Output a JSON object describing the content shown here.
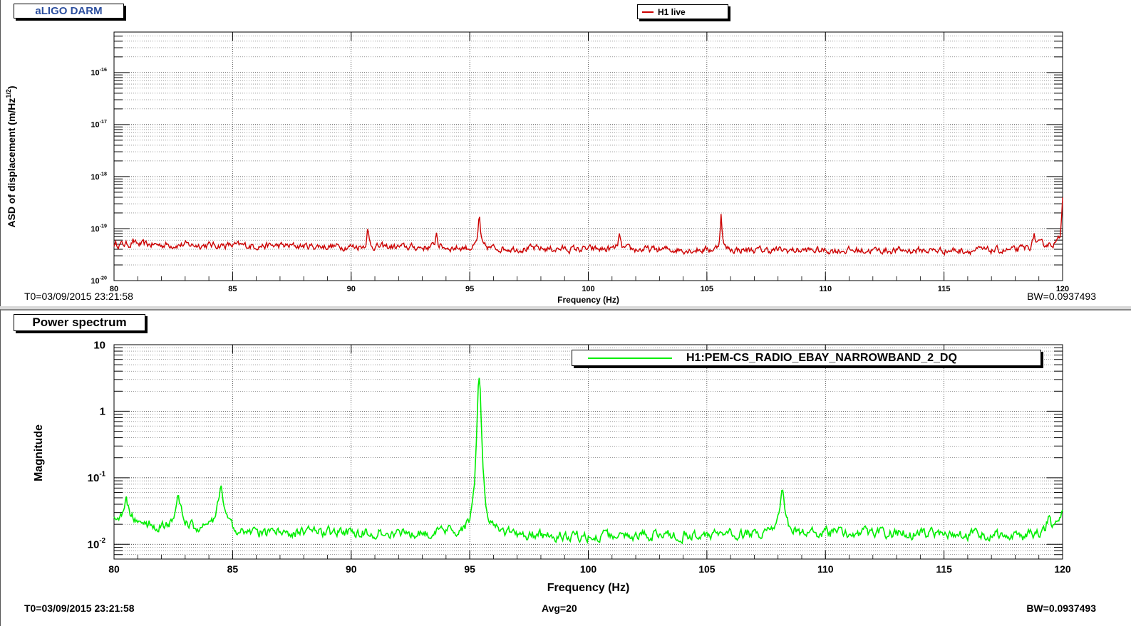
{
  "top_panel": {
    "title": "aLIGO DARM",
    "legend": "H1 live",
    "t0": "T0=03/09/2015 23:21:58",
    "bw": "BW=0.0937493",
    "color": "#cc0000"
  },
  "bottom_panel": {
    "title": "Power spectrum",
    "legend": "H1:PEM-CS_RADIO_EBAY_NARROWBAND_2_DQ",
    "t0": "T0=03/09/2015 23:21:58",
    "avg": "Avg=20",
    "bw": "BW=0.0937493",
    "color": "#00ee00"
  },
  "chart_data": [
    {
      "type": "line",
      "xlabel": "Frequency (Hz)",
      "ylabel": "ASD of displacement (m/Hz^1/2)",
      "xlim": [
        80,
        120
      ],
      "ylim": [
        1e-20,
        6e-16
      ],
      "yscale": "log",
      "grid": true,
      "x_ticks": [
        "80",
        "85",
        "90",
        "95",
        "100",
        "105",
        "110",
        "115",
        "120"
      ],
      "y_ticks": [
        {
          "mantissa": "10",
          "exp": "-20",
          "value": 1e-20
        },
        {
          "mantissa": "10",
          "exp": "-19",
          "value": 1e-19
        },
        {
          "mantissa": "10",
          "exp": "-18",
          "value": 1e-18
        },
        {
          "mantissa": "10",
          "exp": "-17",
          "value": 1e-17
        },
        {
          "mantissa": "10",
          "exp": "-16",
          "value": 1e-16
        }
      ],
      "series": [
        {
          "name": "H1 live",
          "baseline": [
            [
              80,
              5e-20
            ],
            [
              90,
              4.5e-20
            ],
            [
              100,
              4e-20
            ],
            [
              110,
              3.8e-20
            ],
            [
              118,
              3.8e-20
            ],
            [
              119.3,
              5e-20
            ],
            [
              120,
              5e-20
            ]
          ],
          "noise": 0.13,
          "peaks": [
            {
              "x": 80.8,
              "y": 6e-20
            },
            {
              "x": 90.7,
              "y": 9.5e-20
            },
            {
              "x": 93.6,
              "y": 8.5e-20
            },
            {
              "x": 95.4,
              "y": 1.8e-19
            },
            {
              "x": 101.3,
              "y": 7.5e-20
            },
            {
              "x": 105.6,
              "y": 1.9e-19
            },
            {
              "x": 118.8,
              "y": 8e-20
            },
            {
              "x": 120,
              "y": 4.5e-19
            }
          ]
        }
      ]
    },
    {
      "type": "line",
      "xlabel": "Frequency (Hz)",
      "ylabel": "Magnitude",
      "xlim": [
        80,
        120
      ],
      "ylim": [
        0.006,
        10
      ],
      "yscale": "log",
      "grid": true,
      "legend_position": "top-right",
      "x_ticks": [
        "80",
        "85",
        "90",
        "95",
        "100",
        "105",
        "110",
        "115",
        "120"
      ],
      "y_ticks": [
        {
          "mantissa": "10",
          "exp": "-2",
          "value": 0.01
        },
        {
          "mantissa": "10",
          "exp": "-1",
          "value": 0.1
        },
        {
          "mantissa": "1",
          "exp": "",
          "value": 1
        },
        {
          "mantissa": "10",
          "exp": "",
          "value": 10
        }
      ],
      "series": [
        {
          "name": "H1:PEM-CS_RADIO_EBAY_NARROWBAND_2_DQ",
          "baseline": [
            [
              80,
              0.025
            ],
            [
              82,
              0.018
            ],
            [
              86,
              0.015
            ],
            [
              92,
              0.015
            ],
            [
              100,
              0.013
            ],
            [
              105,
              0.014
            ],
            [
              110,
              0.015
            ],
            [
              115,
              0.014
            ],
            [
              120,
              0.013
            ]
          ],
          "noise": 0.15,
          "peaks": [
            {
              "x": 80.5,
              "y": 0.045
            },
            {
              "x": 82.7,
              "y": 0.055
            },
            {
              "x": 84.5,
              "y": 0.075
            },
            {
              "x": 95.4,
              "y": 3.5
            },
            {
              "x": 108.2,
              "y": 0.055
            },
            {
              "x": 119.4,
              "y": 0.022
            },
            {
              "x": 120,
              "y": 0.035
            }
          ]
        }
      ]
    }
  ]
}
